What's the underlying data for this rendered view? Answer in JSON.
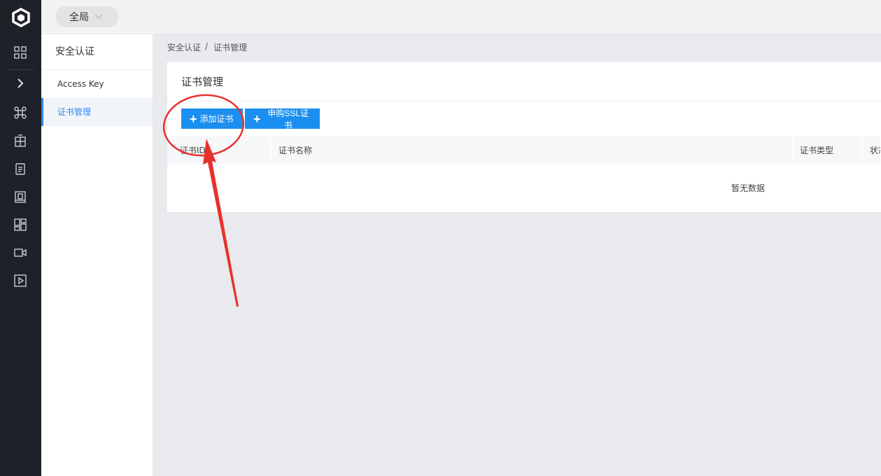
{
  "topbar": {
    "scope_label": "全局"
  },
  "sidebar_icons": [
    "grid-icon",
    "chevron-right-icon",
    "command-icon",
    "building-icon",
    "notebook-icon",
    "book-icon",
    "dashboard-icon",
    "video-icon",
    "play-icon"
  ],
  "subnav": {
    "title": "安全认证",
    "items": [
      {
        "label": "Access Key"
      },
      {
        "label": "证书管理"
      }
    ]
  },
  "breadcrumb": {
    "parent": "安全认证",
    "separator": "/",
    "current": "证书管理"
  },
  "card": {
    "title": "证书管理",
    "add_button": "添加证书",
    "buy_button": "申购SSL证书",
    "table": {
      "columns": [
        "证书ID",
        "证书名称",
        "证书类型",
        "状态"
      ],
      "empty_text": "暂无数据"
    }
  },
  "colors": {
    "accent": "#1b8ff0",
    "annotation": "#e8312c",
    "sidebar_bg": "#1f2129"
  }
}
